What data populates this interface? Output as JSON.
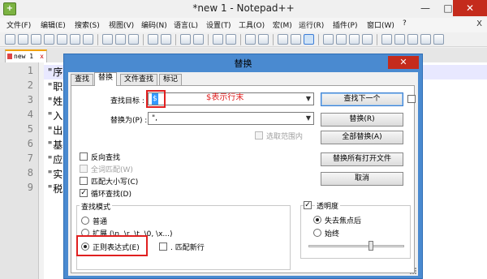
{
  "window": {
    "title": "*new 1 - Notepad++",
    "min_glyph": "—",
    "max_glyph": "□",
    "close_glyph": "✕"
  },
  "menu": {
    "items": [
      "文件(F)",
      "编辑(E)",
      "搜索(S)",
      "视图(V)",
      "编码(N)",
      "语言(L)",
      "设置(T)",
      "工具(O)",
      "宏(M)",
      "运行(R)",
      "插件(P)",
      "窗口(W)",
      "?"
    ],
    "close_glyph": "X"
  },
  "doc_tab": {
    "label": "new 1",
    "close_glyph": "x"
  },
  "editor": {
    "line_numbers": [
      "1",
      "2",
      "3",
      "4",
      "5",
      "6",
      "7",
      "8",
      "9"
    ],
    "lines": [
      "\"序",
      "\"职",
      "\"姓",
      "\"入",
      "\"出",
      "\"基",
      "\"应",
      "\"实",
      "\"税"
    ]
  },
  "dialog": {
    "title": "替换",
    "close_glyph": "✕",
    "tabs": [
      "查找",
      "替换",
      "文件查找",
      "标记"
    ],
    "active_tab": "替换",
    "find_label": "查找目标 :",
    "find_value": "$",
    "replace_label": "替换为(P) :",
    "replace_value": "\",",
    "in_selection_label": "选取范围内",
    "buttons": {
      "find_next": "查找下一个",
      "replace": "替换(R)",
      "replace_all": "全部替换(A)",
      "replace_all_open": "替换所有打开文件",
      "cancel": "取消"
    },
    "options": {
      "backward": "反向查找",
      "whole_word": "全词匹配(W)",
      "match_case": "匹配大小写(C)",
      "wrap": "循环查找(D)"
    },
    "search_mode": {
      "title": "查找模式",
      "normal": "普通",
      "extended": "扩展 (\\n, \\r, \\t, \\0, \\x...)",
      "regex": "正则表达式(E)",
      "dot_newline": ". 匹配新行",
      "selected": "regex"
    },
    "transparency": {
      "title": "透明度",
      "on_lose_focus": "失去焦点后",
      "always": "始终",
      "selected": "on_lose_focus",
      "enabled": true
    },
    "annotation": "$表示行末"
  }
}
